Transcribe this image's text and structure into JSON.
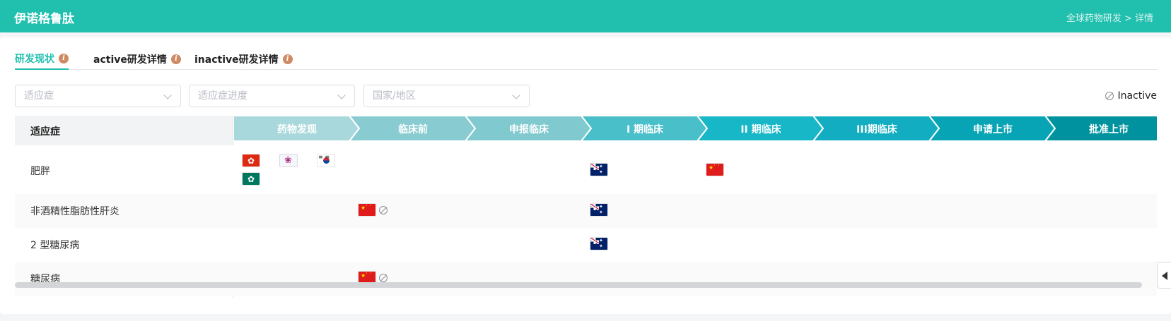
{
  "header": {
    "title": "伊诺格鲁肽",
    "breadcrumb": "全球药物研发 > 详情"
  },
  "tabs": [
    {
      "label": "研发现状",
      "active": true
    },
    {
      "label": "active研发详情",
      "active": false
    },
    {
      "label": "inactive研发详情",
      "active": false
    }
  ],
  "filters": [
    {
      "placeholder": "适应症"
    },
    {
      "placeholder": "适应症进度"
    },
    {
      "placeholder": "国家/地区"
    }
  ],
  "legend": {
    "label": "Inactive"
  },
  "table": {
    "indication_header": "适应症",
    "stages": [
      "药物发现",
      "临床前",
      "申报临床",
      "I 期临床",
      "II 期临床",
      "III期临床",
      "申请上市",
      "批准上市"
    ],
    "rows": [
      {
        "indication": "肥胖",
        "entries": [
          {
            "stage": 0,
            "flags": [
              "hong-kong",
              "taiwan",
              "south-korea",
              "macau"
            ],
            "inactive": false
          },
          {
            "stage": 3,
            "flags": [
              "australia"
            ],
            "inactive": false
          },
          {
            "stage": 4,
            "flags": [
              "china"
            ],
            "inactive": false
          }
        ]
      },
      {
        "indication": "非酒精性脂肪性肝炎",
        "entries": [
          {
            "stage": 1,
            "flags": [
              "china"
            ],
            "inactive": true
          },
          {
            "stage": 3,
            "flags": [
              "australia"
            ],
            "inactive": false
          }
        ]
      },
      {
        "indication": "2 型糖尿病",
        "entries": [
          {
            "stage": 3,
            "flags": [
              "australia"
            ],
            "inactive": false
          }
        ]
      },
      {
        "indication": "糖尿病",
        "entries": [
          {
            "stage": 1,
            "flags": [
              "china"
            ],
            "inactive": true
          }
        ]
      }
    ]
  },
  "colors": {
    "brand": "#21bfae",
    "stage_colors": [
      "#a9d8dc",
      "#88ccd1",
      "#80c9cf",
      "#48bfc9",
      "#17b7c8",
      "#12adc0",
      "#07a4b6",
      "#00939f"
    ]
  }
}
